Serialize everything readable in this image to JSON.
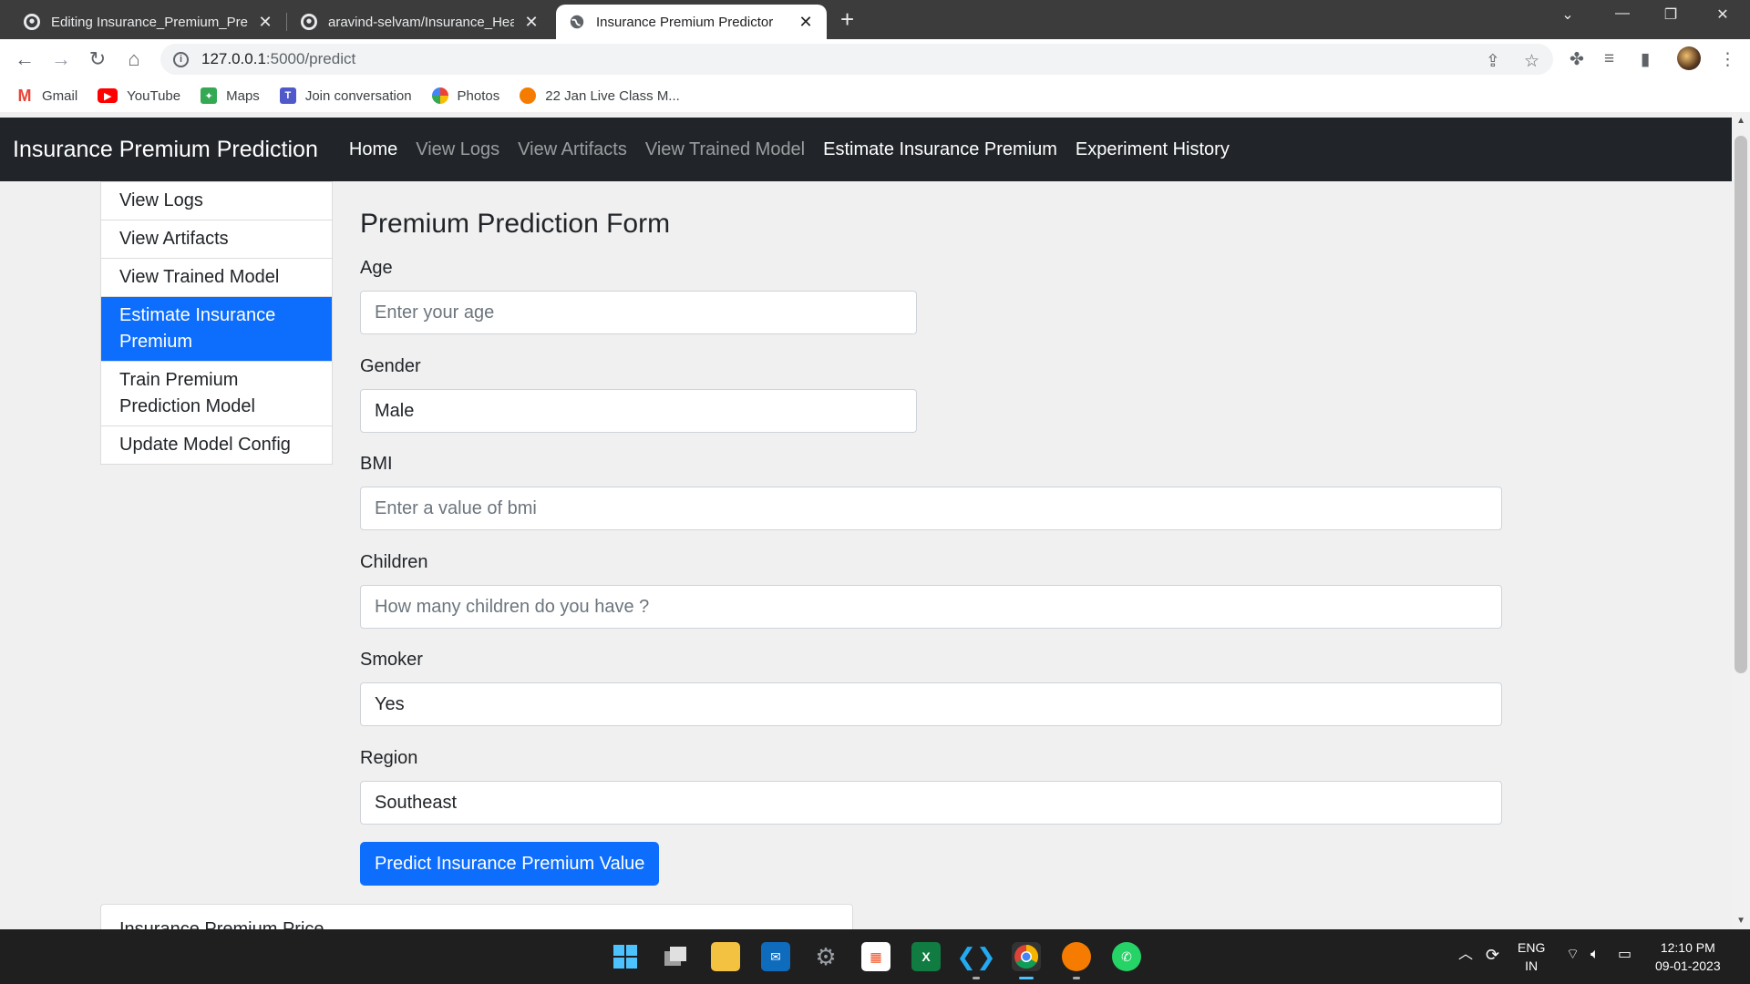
{
  "browser": {
    "tabs": [
      {
        "title": "Editing Insurance_Premium_Pred",
        "icon": "github-icon",
        "active": false
      },
      {
        "title": "aravind-selvam/Insurance_Health",
        "icon": "github-icon",
        "active": false
      },
      {
        "title": "Insurance Premium Predictor",
        "icon": "globe-icon",
        "active": true
      }
    ],
    "url_host": "127.0.0.1",
    "url_path": ":5000/predict",
    "bookmarks": [
      {
        "label": "Gmail",
        "icon": "gmail-icon",
        "color": "#ea4335"
      },
      {
        "label": "YouTube",
        "icon": "youtube-icon",
        "color": "#ff0000"
      },
      {
        "label": "Maps",
        "icon": "maps-icon",
        "color": "#34a853"
      },
      {
        "label": "Join conversation",
        "icon": "teams-icon",
        "color": "#5059c9"
      },
      {
        "label": "Photos",
        "icon": "photos-icon",
        "color": "#fbbc04"
      },
      {
        "label": "22 Jan Live Class M...",
        "icon": "ineuron-icon",
        "color": "#f57c00"
      }
    ]
  },
  "site": {
    "brand": "Insurance Premium Prediction",
    "nav": [
      {
        "label": "Home",
        "active": true
      },
      {
        "label": "View Logs",
        "active": false
      },
      {
        "label": "View Artifacts",
        "active": false
      },
      {
        "label": "View Trained Model",
        "active": false
      },
      {
        "label": "Estimate Insurance Premium",
        "active": true
      },
      {
        "label": "Experiment History",
        "active": true
      }
    ],
    "sidebar": [
      {
        "label": "View Logs",
        "active": false
      },
      {
        "label": "View Artifacts",
        "active": false
      },
      {
        "label": "View Trained Model",
        "active": false
      },
      {
        "label": "Estimate Insurance Premium",
        "active": true
      },
      {
        "label": "Train Premium Prediction Model",
        "active": false
      },
      {
        "label": "Update Model Config",
        "active": false
      }
    ],
    "accent_color": "#0d6efd",
    "form": {
      "title": "Premium Prediction Form",
      "age": {
        "label": "Age",
        "placeholder": "Enter your age",
        "value": ""
      },
      "gender": {
        "label": "Gender",
        "value": "Male"
      },
      "bmi": {
        "label": "BMI",
        "placeholder": "Enter a value of bmi",
        "value": ""
      },
      "children": {
        "label": "Children",
        "placeholder": "How many children do you have ?",
        "value": ""
      },
      "smoker": {
        "label": "Smoker",
        "value": "Yes"
      },
      "region": {
        "label": "Region",
        "value": "Southeast"
      },
      "submit_label": "Predict Insurance Premium Value"
    },
    "result_card_title": "Insurance Premium Price"
  },
  "taskbar": {
    "apps": [
      "windows-start-icon",
      "task-view-icon",
      "file-explorer-icon",
      "mail-icon",
      "settings-icon",
      "microsoft-store-icon",
      "excel-icon",
      "vscode-icon",
      "chrome-icon",
      "ineuron-icon",
      "whatsapp-icon"
    ],
    "lang_line1": "ENG",
    "lang_line2": "IN",
    "time": "12:10 PM",
    "date": "09-01-2023"
  }
}
